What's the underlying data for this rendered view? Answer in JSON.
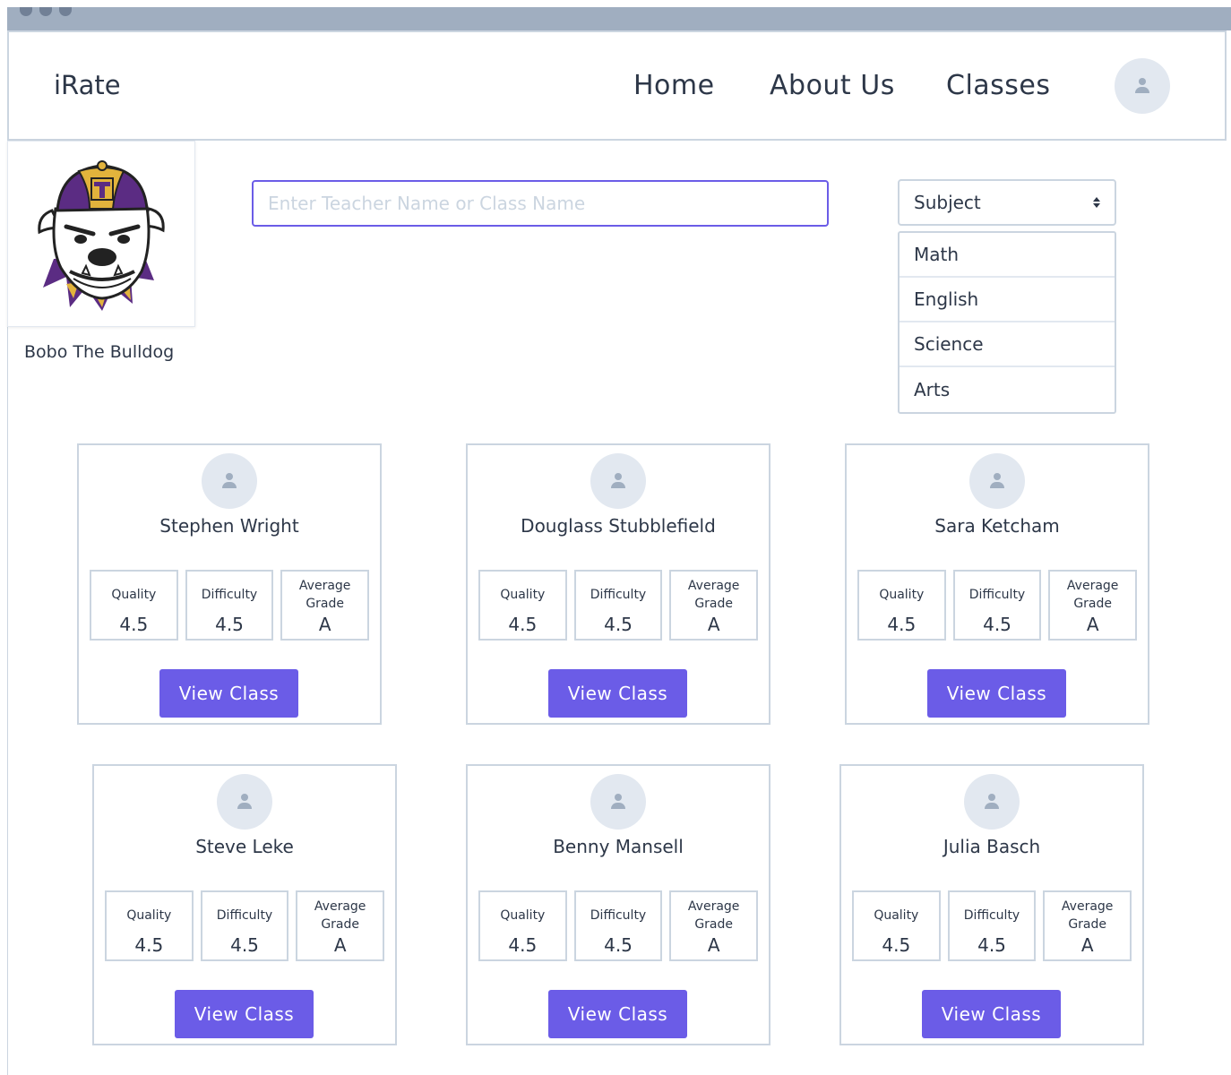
{
  "nav": {
    "brand": "iRate",
    "links": [
      "Home",
      "About Us",
      "Classes"
    ],
    "avatar_icon": "user-icon"
  },
  "profile": {
    "name": "Bobo The Bulldog",
    "logo": "bulldog-mascot-logo"
  },
  "search": {
    "placeholder": "Enter Teacher Name or Class Name",
    "value": ""
  },
  "subject_select": {
    "selected": "Subject",
    "options": [
      "Math",
      "English",
      "Science",
      "Arts"
    ]
  },
  "stat_labels": {
    "quality": "Quality",
    "difficulty": "Difficulty",
    "average_grade": "Average Grade"
  },
  "button_label": "View Class",
  "teachers": [
    {
      "name": "Stephen Wright",
      "quality": "4.5",
      "difficulty": "4.5",
      "average_grade": "A"
    },
    {
      "name": "Douglass Stubblefield",
      "quality": "4.5",
      "difficulty": "4.5",
      "average_grade": "A"
    },
    {
      "name": "Sara Ketcham",
      "quality": "4.5",
      "difficulty": "4.5",
      "average_grade": "A"
    },
    {
      "name": "Steve Leke",
      "quality": "4.5",
      "difficulty": "4.5",
      "average_grade": "A"
    },
    {
      "name": "Benny Mansell",
      "quality": "4.5",
      "difficulty": "4.5",
      "average_grade": "A"
    },
    {
      "name": "Julia Basch",
      "quality": "4.5",
      "difficulty": "4.5",
      "average_grade": "A"
    }
  ],
  "colors": {
    "accent": "#6b5ce7",
    "border": "#cbd5e0",
    "avatar_bg": "#e2e8f0",
    "text": "#2d3748"
  }
}
